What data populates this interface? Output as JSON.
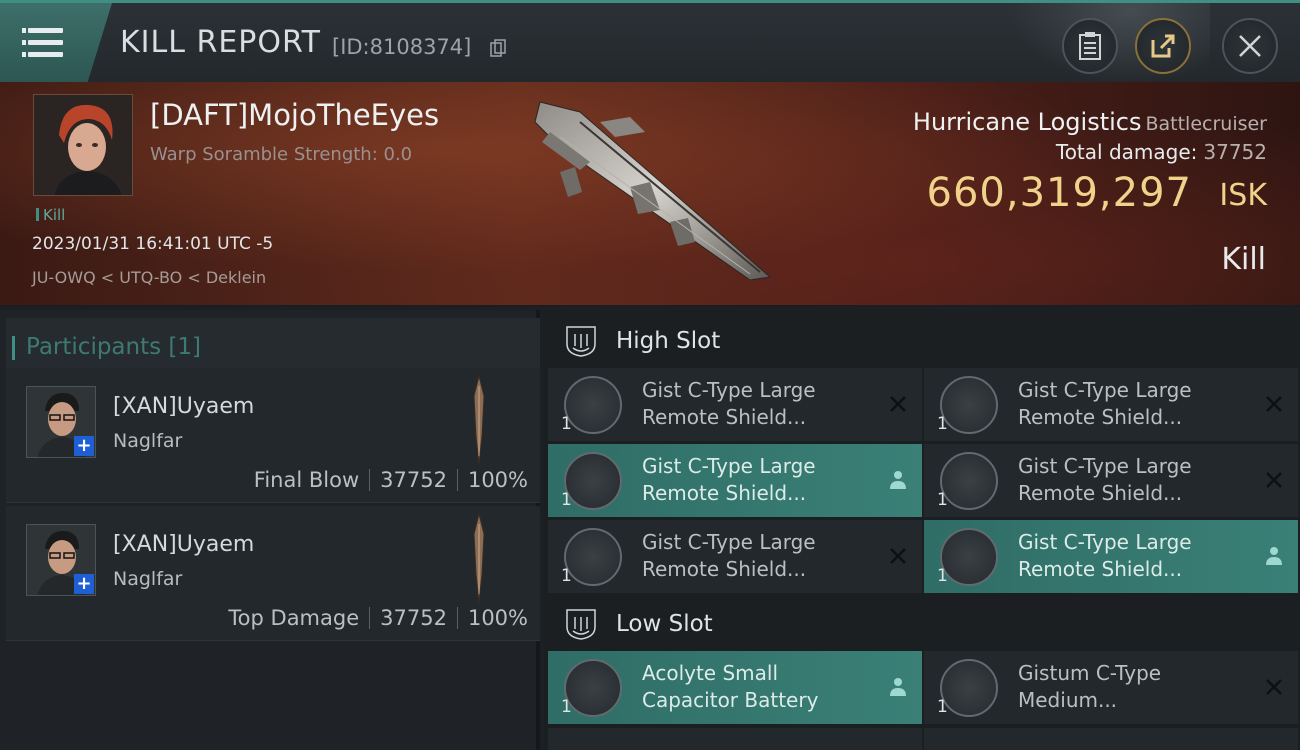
{
  "header": {
    "title": "KILL REPORT",
    "report_id": "[ID:8108374]",
    "icons": [
      "menu-icon",
      "copy-icon",
      "clipboard-icon",
      "share-icon",
      "close-icon"
    ]
  },
  "victim": {
    "name": "[DAFT]MojoTheEyes",
    "scramble": "Warp Soramble Strength: 0.0",
    "tag": "Kill",
    "timestamp": "2023/01/31 16:41:01 UTC -5",
    "location": "JU-OWQ < UTQ-BO < Deklein",
    "ship": "Hurricane Logistics",
    "ship_class": "Battlecruiser",
    "total_damage_label": "Total damage:",
    "total_damage": "37752",
    "isk_value": "660,319,297",
    "isk_unit": "ISK",
    "result": "Kill"
  },
  "participants": {
    "label": "Participants [1]",
    "rows": [
      {
        "name": "[XAN]Uyaem",
        "ship": "Naglfar",
        "role": "Final Blow",
        "damage": "37752",
        "percent": "100%"
      },
      {
        "name": "[XAN]Uyaem",
        "ship": "Naglfar",
        "role": "Top Damage",
        "damage": "37752",
        "percent": "100%"
      }
    ]
  },
  "fitting": {
    "high_slot": {
      "label": "High Slot",
      "modules": [
        {
          "qty": "1",
          "line1": "Gist C-Type Large",
          "line2": "Remote Shield...",
          "state": "destroyed"
        },
        {
          "qty": "1",
          "line1": "Gist C-Type Large",
          "line2": "Remote Shield...",
          "state": "destroyed"
        },
        {
          "qty": "1",
          "line1": "Gist C-Type Large",
          "line2": "Remote Shield...",
          "state": "dropped"
        },
        {
          "qty": "1",
          "line1": "Gist C-Type Large",
          "line2": "Remote Shield...",
          "state": "destroyed"
        },
        {
          "qty": "1",
          "line1": "Gist C-Type Large",
          "line2": "Remote Shield...",
          "state": "destroyed"
        },
        {
          "qty": "1",
          "line1": "Gist C-Type Large",
          "line2": "Remote Shield...",
          "state": "dropped"
        }
      ]
    },
    "low_slot": {
      "label": "Low Slot",
      "modules": [
        {
          "qty": "1",
          "line1": "Acolyte Small",
          "line2": "Capacitor Battery",
          "state": "dropped"
        },
        {
          "qty": "1",
          "line1": "Gistum C-Type",
          "line2": "Medium...",
          "state": "destroyed"
        }
      ]
    }
  },
  "colors": {
    "accent": "#3f8f85",
    "isk": "#f0d28a",
    "highlight": "#2f6d66"
  }
}
